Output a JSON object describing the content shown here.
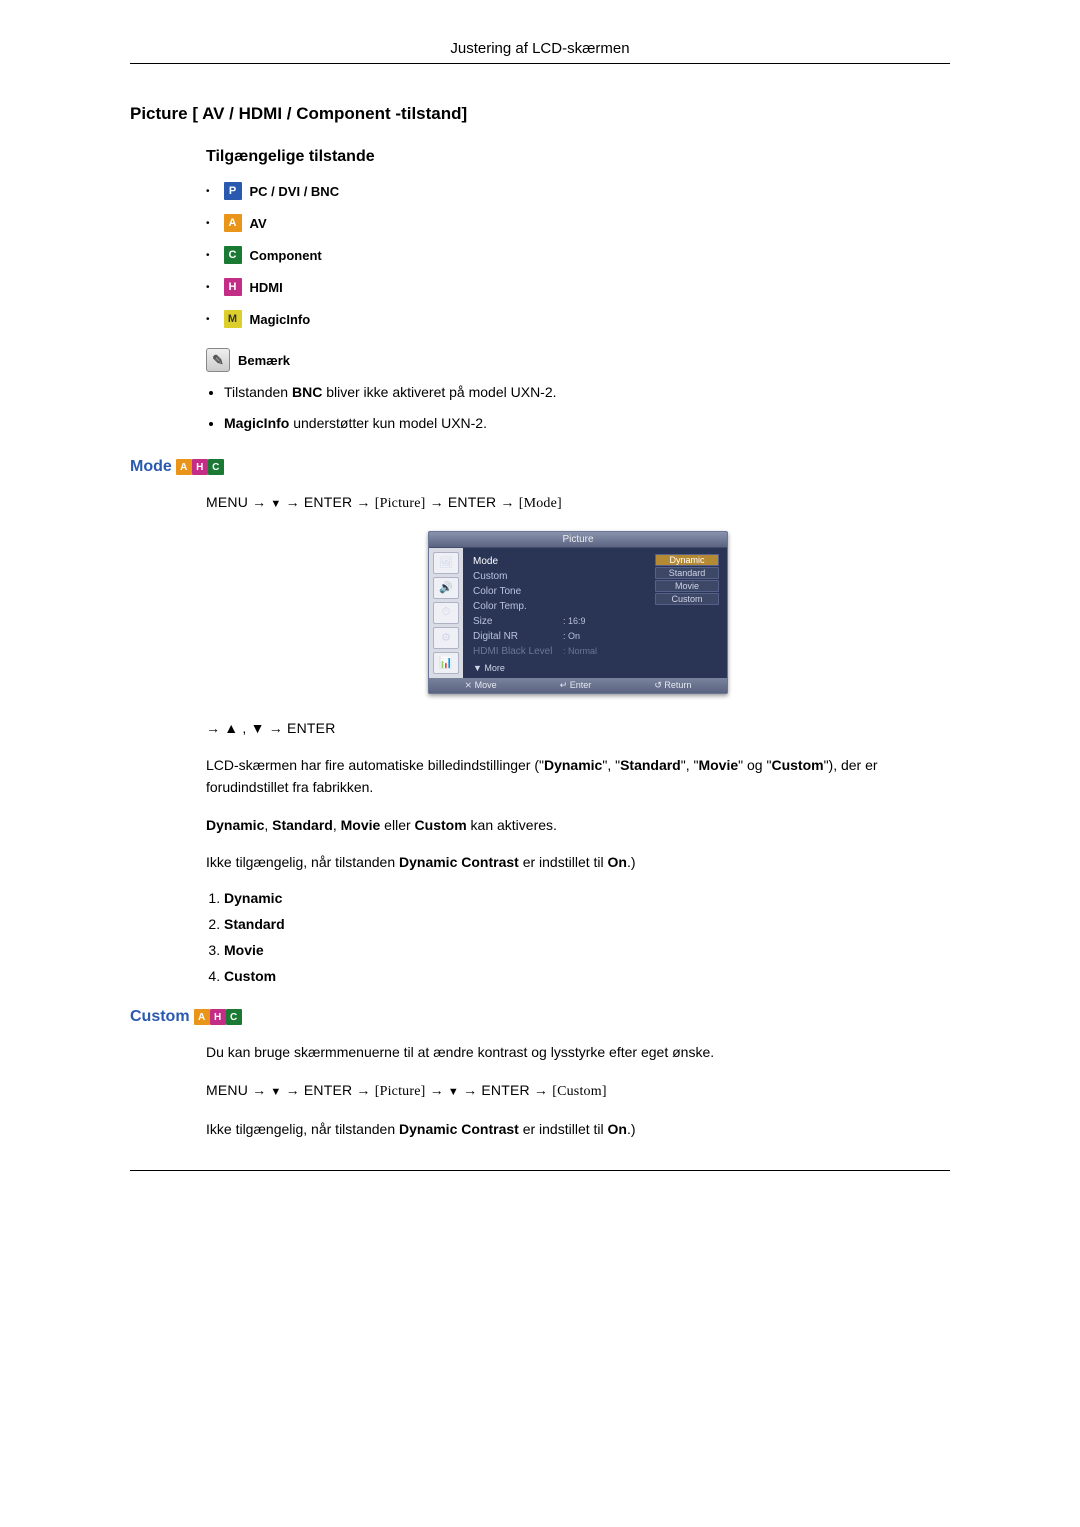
{
  "header": {
    "title": "Justering af LCD-skærmen"
  },
  "section1": {
    "title": "Picture [ AV / HDMI / Component -tilstand]",
    "sub": "Tilgængelige tilstande",
    "modes": [
      {
        "badge": "P",
        "label": "PC / DVI / BNC"
      },
      {
        "badge": "A",
        "label": "AV"
      },
      {
        "badge": "C",
        "label": "Component"
      },
      {
        "badge": "H",
        "label": "HDMI"
      },
      {
        "badge": "M",
        "label": "MagicInfo"
      }
    ],
    "note_title": "Bemærk",
    "note1_pre": "Tilstanden ",
    "note1_bold": "BNC",
    "note1_post": " bliver ikke aktiveret på model UXN-2.",
    "note2_bold": "MagicInfo",
    "note2_post": " understøtter kun model UXN-2."
  },
  "mode": {
    "heading": "Mode",
    "path_pre": "MENU → ",
    "path_enter1": " → ENTER → ",
    "path_picture": "[Picture]",
    "path_enter2": " → ENTER → ",
    "path_mode": "[Mode]",
    "osd": {
      "title": "Picture",
      "rows": [
        {
          "label": "Mode",
          "value": ""
        },
        {
          "label": "Custom",
          "value": ""
        },
        {
          "label": "Color Tone",
          "value": ""
        },
        {
          "label": "Color Temp.",
          "value": ""
        },
        {
          "label": "Size",
          "value": ": 16:9"
        },
        {
          "label": "Digital NR",
          "value": ": On"
        },
        {
          "label": "HDMI Black Level",
          "value": ": Normal"
        }
      ],
      "options": [
        "Dynamic",
        "Standard",
        "Movie",
        "Custom"
      ],
      "more": "▼ More",
      "foot": {
        "move": "Move",
        "enter": "Enter",
        "return": "Return"
      }
    },
    "path2": "→ ▲ , ▼ → ENTER",
    "p1_a": "LCD-skærmen har fire automatiske billedindstillinger (\"",
    "p1_b1": "Dynamic",
    "p1_c": "\", \"",
    "p1_b2": "Standard",
    "p1_d": "\", \"",
    "p1_b3": "Movie",
    "p1_e": "\" og \"",
    "p1_b4": "Custom",
    "p1_f": "\"), der er forudindstillet fra fabrikken.",
    "p2_b1": "Dynamic",
    "p2_c1": ", ",
    "p2_b2": "Standard",
    "p2_c2": ", ",
    "p2_b3": "Movie",
    "p2_c3": " eller ",
    "p2_b4": "Custom",
    "p2_c4": " kan aktiveres.",
    "p3_a": "Ikke tilgængelig, når tilstanden ",
    "p3_b": "Dynamic Contrast",
    "p3_c": " er indstillet til ",
    "p3_d": "On",
    "p3_e": ".)",
    "list": [
      "Dynamic",
      "Standard",
      "Movie",
      "Custom"
    ]
  },
  "custom": {
    "heading": "Custom",
    "p1": "Du kan bruge skærmmenuerne til at ændre kontrast og lysstyrke efter eget ønske.",
    "path_pre": "MENU → ",
    "path_enter1": " → ENTER → ",
    "path_picture": "[Picture]",
    "path_mid": " → ",
    "path_enter2": " → ENTER → ",
    "path_custom": "[Custom]",
    "p3_a": "Ikke tilgængelig, når tilstanden ",
    "p3_b": "Dynamic Contrast",
    "p3_c": " er indstillet til ",
    "p3_d": "On",
    "p3_e": ".)"
  }
}
